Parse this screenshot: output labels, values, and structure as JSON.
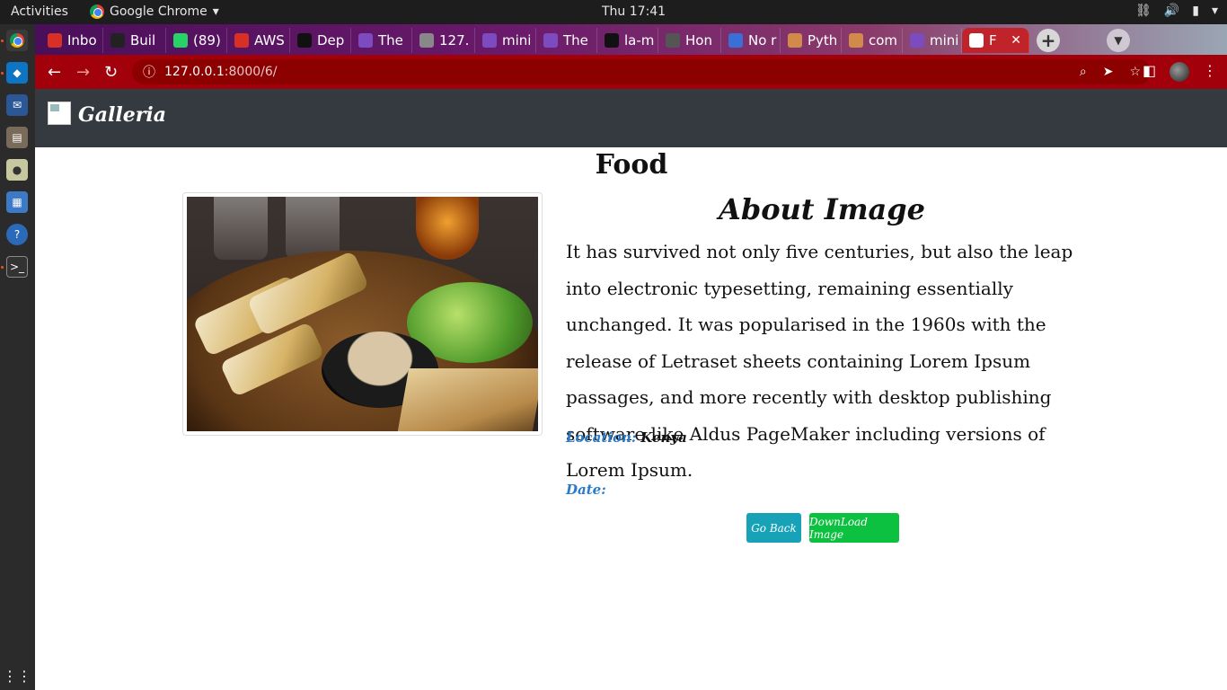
{
  "os": {
    "activities": "Activities",
    "app_name": "Google Chrome",
    "clock": "Thu 17:41"
  },
  "browser": {
    "tabs": [
      {
        "label": "Inbo",
        "icon": "gmail-icon",
        "color": "#d93025"
      },
      {
        "label": "Buil",
        "icon": "site-icon",
        "color": "#222222"
      },
      {
        "label": "(89)",
        "icon": "whatsapp-icon",
        "color": "#25d366"
      },
      {
        "label": "AWS",
        "icon": "gmail-icon",
        "color": "#d93025"
      },
      {
        "label": "Dep",
        "icon": "github-icon",
        "color": "#111111"
      },
      {
        "label": "The",
        "icon": "heroku-icon",
        "color": "#7b4bbf"
      },
      {
        "label": "127.",
        "icon": "loading-icon",
        "color": "#888888"
      },
      {
        "label": "mini",
        "icon": "heroku-icon",
        "color": "#7b4bbf"
      },
      {
        "label": "The",
        "icon": "heroku-icon",
        "color": "#7b4bbf"
      },
      {
        "label": "la-m",
        "icon": "github-icon",
        "color": "#111111"
      },
      {
        "label": "Hon",
        "icon": "globe-icon",
        "color": "#555555"
      },
      {
        "label": "No r",
        "icon": "globe-icon",
        "color": "#3b6fd8"
      },
      {
        "label": "Pyth",
        "icon": "python-icon",
        "color": "#d28a4a"
      },
      {
        "label": "com",
        "icon": "python-icon",
        "color": "#d28a4a"
      },
      {
        "label": "mini",
        "icon": "heroku-icon",
        "color": "#7b4bbf"
      },
      {
        "label": "F",
        "icon": "globe-icon",
        "color": "#ffffff",
        "active": true
      }
    ],
    "url_host": "127.0.0.1",
    "url_path": ":8000/6/"
  },
  "site": {
    "brand": "Galleria"
  },
  "image_page": {
    "category": "Food",
    "about_title": "About Image",
    "description": "It has survived not only five centuries, but also the leap into electronic typesetting, remaining essentially unchanged. It was popularised in the 1960s with the release of Letraset sheets containing Lorem Ipsum passages, and more recently with desktop publishing software like Aldus PageMaker including versions of Lorem Ipsum.",
    "location_label": "Location:",
    "location_value": "Kenya",
    "date_label": "Date:",
    "date_value": "",
    "back_button": "Go Back",
    "download_button": "DownLoad Image"
  },
  "colors": {
    "navbar": "#343a40",
    "toolbar": "#a2000b",
    "accent_blue": "#2a7ac8",
    "btn_back": "#17a2b8",
    "btn_download": "#0cc040"
  }
}
